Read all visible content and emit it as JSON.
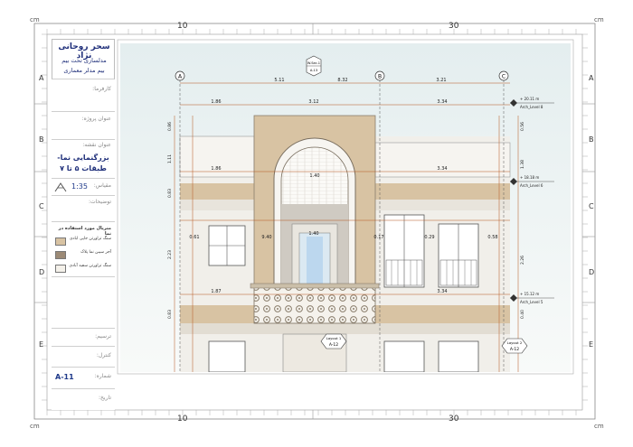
{
  "ruler": {
    "unit_left": "cm",
    "unit_right": "cm",
    "unit_bottom_left": "cm",
    "unit_bottom_right": "cm",
    "top_10": "10",
    "top_30": "30",
    "bottom_10": "10",
    "bottom_30": "30",
    "rows": [
      "A",
      "B",
      "C",
      "D",
      "E"
    ]
  },
  "title_block": {
    "author": "سحر روحانی نژاد",
    "course_line1": "مدلسازی تحت بیم",
    "course_line2": "بیم مدلر معماری",
    "employer_label": "کارفرما:",
    "project_label": "عنوان پروژه:",
    "sheet_title_label": "عنوان نقشه:",
    "sheet_title_line1": "بزرگنمایی نما-",
    "sheet_title_line2": "طبقات ۵ تا ۷",
    "scale_label": "مقیاس:",
    "scale_value": "1:35",
    "notes_label": "توضیحات:",
    "legend_title": "متریال مورد استفاده در نما",
    "legend": [
      {
        "label": "سنگ تراورتن جاپی ابادی",
        "color": "#d8c3a3"
      },
      {
        "label": "آجر سیبن نما پلاک",
        "color": "#9c8a76"
      },
      {
        "label": "سنگ تراورتن سفید آبادی",
        "color": "#f4f1ea"
      }
    ],
    "drawn_label": "ترسیم:",
    "check_label": "کنترل:",
    "number_label": "شماره:",
    "number_value": "A-11",
    "date_label": "تاریخ:"
  },
  "drawing": {
    "grid_labels": [
      "A",
      "B",
      "C"
    ],
    "section_tag_top": "W.Sec.1",
    "section_tag_bottom": "A-13",
    "dims_top": [
      "5.11",
      "8.32",
      "3.21"
    ],
    "dim_center_top": "3.12",
    "dims_row2": [
      "1.86",
      "3.34"
    ],
    "dims_row3": [
      "1.86",
      "3.34"
    ],
    "dim_window": "1.40",
    "dims_mid_left": [
      "0.61",
      "9.40",
      "1.40"
    ],
    "dims_mid_right": [
      "0.17",
      "0.29",
      "0.58"
    ],
    "dims_bottom": [
      "1.87",
      "3.34"
    ],
    "levels": [
      {
        "elev": "+ 20.11 m",
        "name": "Arch_Level 8"
      },
      {
        "elev": "+ 18.18 m",
        "name": "Arch_Level 6"
      },
      {
        "elev": "+ 15.12 m",
        "name": "Arch_Level 5"
      }
    ],
    "tag_layout1_name": "Layout 1",
    "tag_layout1_sheet": "A-12",
    "tag_layout2_name": "Layout 2",
    "tag_layout2_sheet": "A-12",
    "v_dims_left": [
      "0.86",
      "1.11",
      "0.83",
      "2.23",
      "0.83"
    ],
    "v_dims_right": [
      "0.56",
      "1.38",
      "2.26",
      "0.40"
    ],
    "colors": {
      "facade_wall": "#f1efea",
      "travertine": "#d8c3a3",
      "brick": "#9c8a76",
      "dim_red": "#b5541c",
      "sky_top": "#eaf1f2",
      "sky_bottom": "#f7f9f8"
    }
  }
}
